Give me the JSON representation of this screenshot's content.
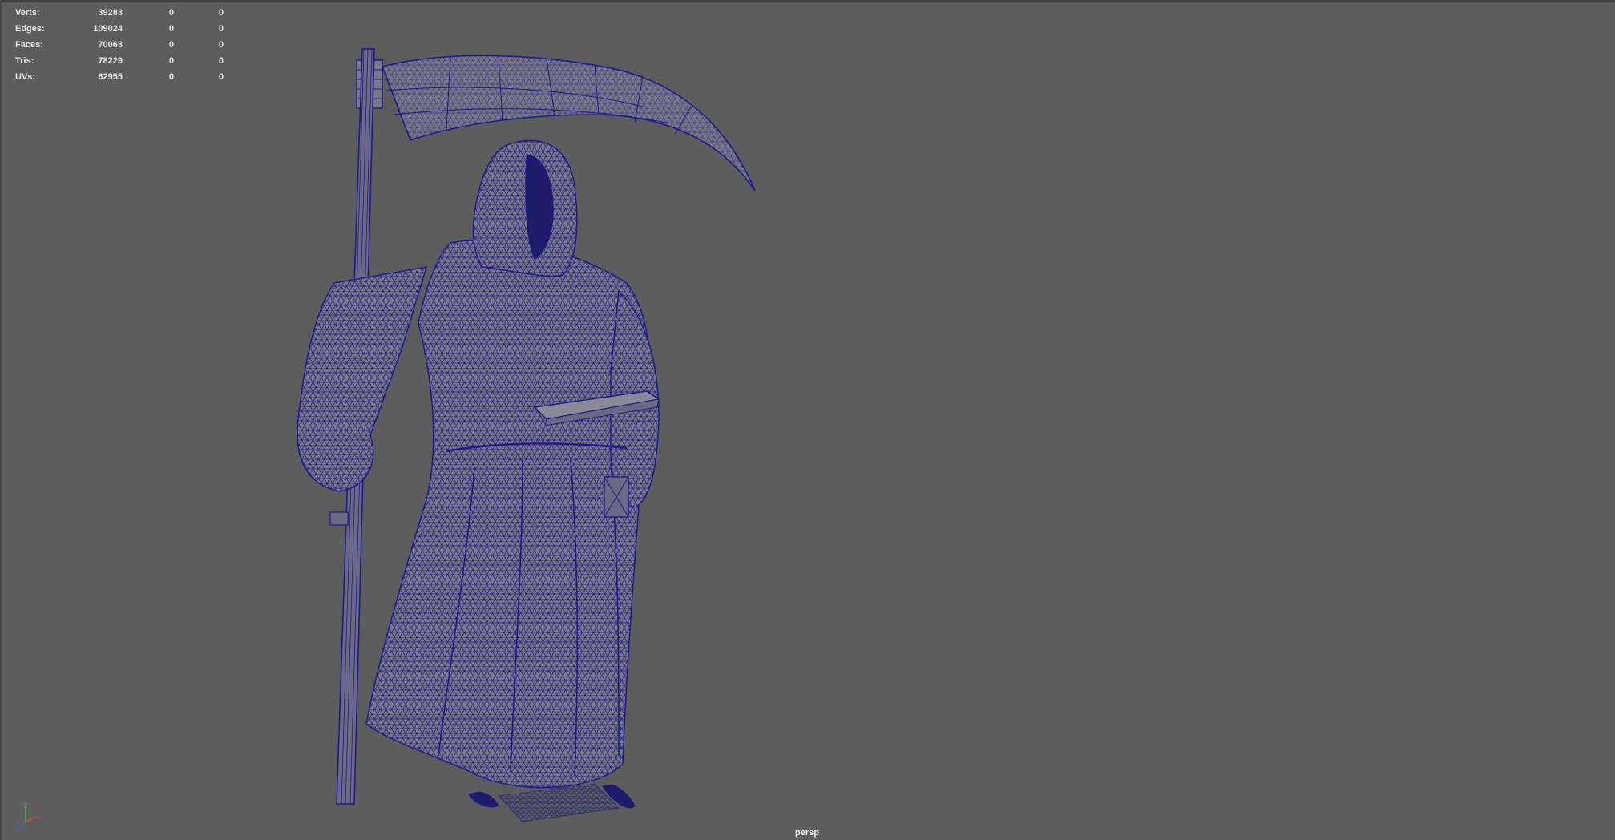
{
  "viewport": {
    "camera": "persp",
    "background_color": "#5d5d5d",
    "wireframe_color": "#1c1c8c"
  },
  "hud": {
    "stats": [
      {
        "label": "Verts:",
        "total": "39283",
        "selected": "0",
        "components": "0"
      },
      {
        "label": "Edges:",
        "total": "109024",
        "selected": "0",
        "components": "0"
      },
      {
        "label": "Faces:",
        "total": "70063",
        "selected": "0",
        "components": "0"
      },
      {
        "label": "Tris:",
        "total": "78229",
        "selected": "0",
        "components": "0"
      },
      {
        "label": "UVs:",
        "total": "62955",
        "selected": "0",
        "components": "0"
      }
    ]
  },
  "axis_gizmo": {
    "labels": [
      "y",
      "z",
      "x"
    ],
    "colors": {
      "x": "#d84040",
      "y": "#40c040",
      "z": "#4060e0"
    }
  },
  "model": {
    "icon": "grim-reaper-wireframe-icon"
  }
}
